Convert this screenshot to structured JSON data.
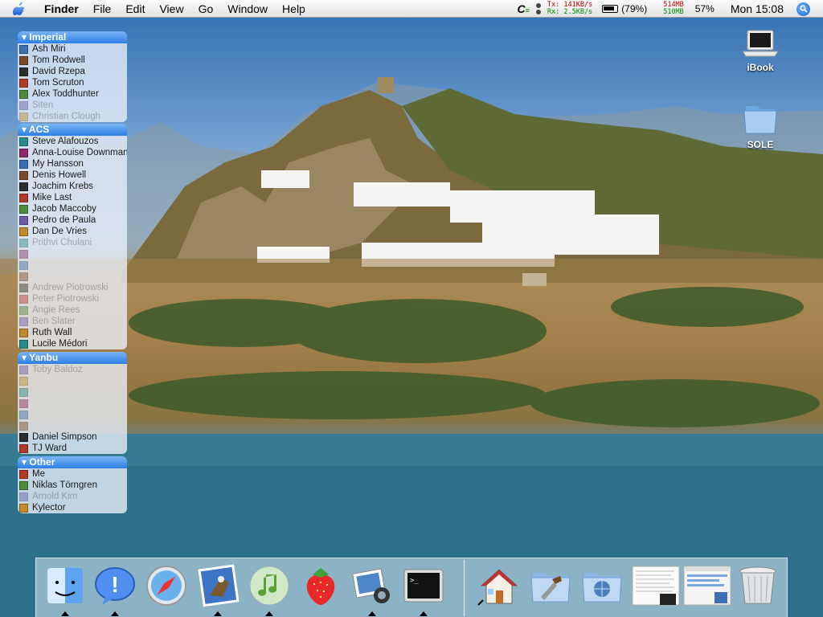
{
  "menubar": {
    "app_name": "Finder",
    "menus": [
      "File",
      "Edit",
      "View",
      "Go",
      "Window",
      "Help"
    ],
    "network": {
      "tx_label": "Tx:",
      "tx_value": "141KB/s",
      "rx_label": "Rx:",
      "rx_value": "2.5KB/s"
    },
    "battery": "(79%)",
    "memory": {
      "top": "514MB",
      "bottom": "510MB"
    },
    "cpu": "57%",
    "clock": "Mon 15:08"
  },
  "buddy_groups": [
    {
      "name": "Imperial",
      "buddies": [
        {
          "name": "Ash Miri",
          "idle": false
        },
        {
          "name": "Tom Rodwell",
          "idle": false
        },
        {
          "name": "David Rzepa",
          "idle": false
        },
        {
          "name": "Tom Scruton",
          "idle": false
        },
        {
          "name": "Alex Toddhunter",
          "idle": false
        },
        {
          "name": "Siten",
          "idle": true
        },
        {
          "name": "Christian Clough",
          "idle": true
        }
      ]
    },
    {
      "name": "ACS",
      "buddies": [
        {
          "name": "Steve Alafouzos",
          "idle": false
        },
        {
          "name": "Anna-Louise Downman",
          "idle": false
        },
        {
          "name": "My Hansson",
          "idle": false
        },
        {
          "name": "Denis Howell",
          "idle": false
        },
        {
          "name": "Joachim Krebs",
          "idle": false
        },
        {
          "name": "Mike Last",
          "idle": false
        },
        {
          "name": "Jacob Maccoby",
          "idle": false
        },
        {
          "name": "Pedro de Paula",
          "idle": false
        },
        {
          "name": "Dan De Vries",
          "idle": false
        },
        {
          "name": "Prithvi Chulani",
          "idle": true
        },
        {
          "name": "",
          "idle": true
        },
        {
          "name": "",
          "idle": true
        },
        {
          "name": "",
          "idle": true
        },
        {
          "name": "Andrew Piotrowski",
          "idle": true
        },
        {
          "name": "Peter Piotrowski",
          "idle": true
        },
        {
          "name": "Angie Rees",
          "idle": true
        },
        {
          "name": "Ben Slater",
          "idle": true
        },
        {
          "name": "Ruth Wall",
          "idle": false
        },
        {
          "name": "Lucile Médori",
          "idle": false
        }
      ]
    },
    {
      "name": "Yanbu",
      "buddies": [
        {
          "name": "Toby Baldoz",
          "idle": true
        },
        {
          "name": "",
          "idle": true
        },
        {
          "name": "",
          "idle": true
        },
        {
          "name": "",
          "idle": true
        },
        {
          "name": "",
          "idle": true
        },
        {
          "name": "",
          "idle": true
        },
        {
          "name": "Daniel Simpson",
          "idle": false
        },
        {
          "name": "TJ Ward",
          "idle": false
        }
      ]
    },
    {
      "name": "Other",
      "buddies": [
        {
          "name": "Me",
          "idle": false
        },
        {
          "name": "Niklas Törngren",
          "idle": false
        },
        {
          "name": "Arnold Kim",
          "idle": true
        },
        {
          "name": "Kylector",
          "idle": false
        }
      ]
    }
  ],
  "desktop_icons": [
    {
      "label": "iBook",
      "icon": "laptop-icon"
    },
    {
      "label": "SOLE",
      "icon": "folder-icon"
    }
  ],
  "dock": {
    "apps": [
      "finder-icon",
      "ichat-icon",
      "safari-icon",
      "mail-icon",
      "itunes-icon",
      "strawberry-icon",
      "iphoto-icon",
      "terminal-icon"
    ],
    "right": [
      "home-icon",
      "utilities-icon",
      "network-folder-icon",
      "window-thumbnail-1",
      "window-thumbnail-2",
      "trash-icon"
    ]
  }
}
